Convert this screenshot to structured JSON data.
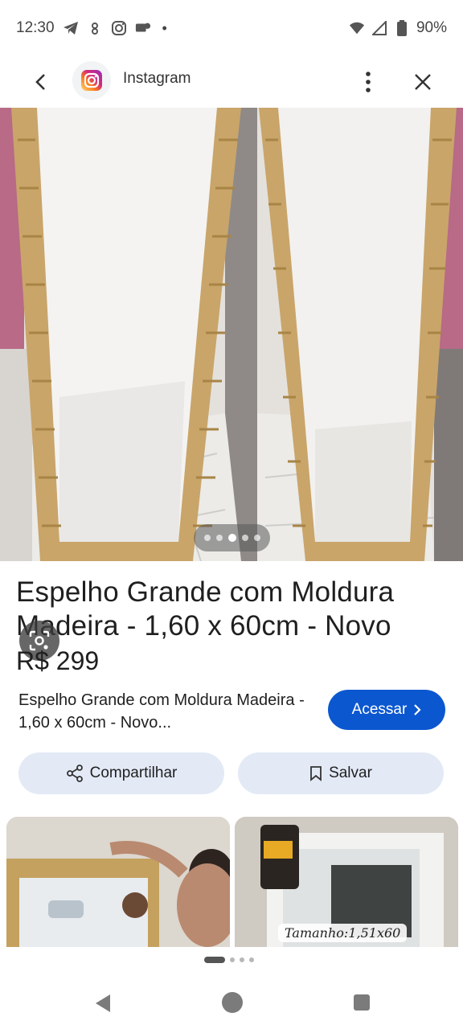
{
  "status_bar": {
    "time": "12:30",
    "battery": "90%"
  },
  "app_bar": {
    "title": "Instagram"
  },
  "product": {
    "title": "Espelho Grande com Moldura Madeira - 1,60 x 60cm - Novo",
    "price": "R$ 299",
    "source_text": "Espelho Grande com Moldura Madeira - 1,60 x 60cm - Novo...",
    "visit_label": "Acessar"
  },
  "actions": {
    "share_label": "Compartilhar",
    "save_label": "Salvar"
  },
  "related": {
    "thumb2_label": "Tamanho:1,51x60"
  },
  "carousel": {
    "count": 5,
    "active_index": 3
  },
  "icons": [
    "back-icon",
    "instagram-icon",
    "more-vert-icon",
    "close-icon",
    "lens-icon",
    "share-icon",
    "bookmark-icon",
    "chevron-right-icon"
  ],
  "colors": {
    "accent": "#0b57d0",
    "chip_bg": "#e3eaf6"
  }
}
